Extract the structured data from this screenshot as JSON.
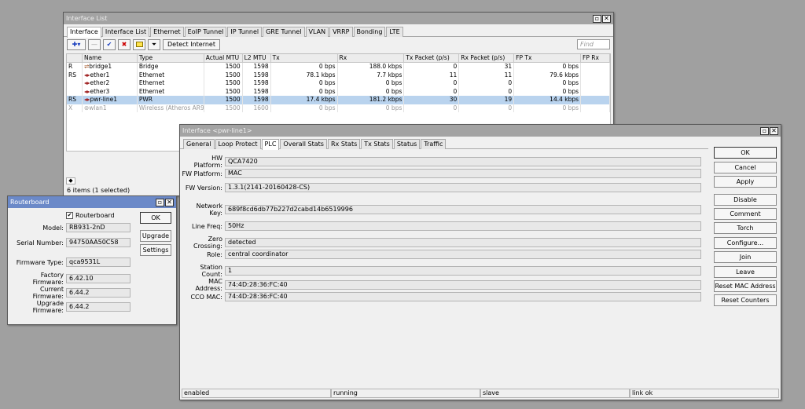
{
  "iface_list": {
    "title": "Interface List",
    "tabs": [
      "Interface",
      "Interface List",
      "Ethernet",
      "EoIP Tunnel",
      "IP Tunnel",
      "GRE Tunnel",
      "VLAN",
      "VRRP",
      "Bonding",
      "LTE"
    ],
    "detect_label": "Detect Internet",
    "find_placeholder": "Find",
    "columns": [
      "",
      "Name",
      "Type",
      "Actual MTU",
      "L2 MTU",
      "Tx",
      "Rx",
      "Tx Packet (p/s)",
      "Rx Packet (p/s)",
      "FP Tx",
      "FP Rx"
    ],
    "rows": [
      [
        "R",
        "bridge1",
        "Bridge",
        "1500",
        "1598",
        "0 bps",
        "188.0 kbps",
        "0",
        "31",
        "0 bps"
      ],
      [
        "RS",
        "ether1",
        "Ethernet",
        "1500",
        "1598",
        "78.1 kbps",
        "7.7 kbps",
        "11",
        "11",
        "79.6 kbps"
      ],
      [
        "",
        "ether2",
        "Ethernet",
        "1500",
        "1598",
        "0 bps",
        "0 bps",
        "0",
        "0",
        "0 bps"
      ],
      [
        "",
        "ether3",
        "Ethernet",
        "1500",
        "1598",
        "0 bps",
        "0 bps",
        "0",
        "0",
        "0 bps"
      ],
      [
        "RS",
        "pwr-line1",
        "PWR",
        "1500",
        "1598",
        "17.4 kbps",
        "181.2 kbps",
        "30",
        "19",
        "14.4 kbps"
      ],
      [
        "X",
        "wlan1",
        "Wireless (Atheros AR9...",
        "1500",
        "1600",
        "0 bps",
        "0 bps",
        "0",
        "0",
        "0 bps"
      ]
    ],
    "footer": "6 items (1 selected)"
  },
  "routerboard": {
    "title": "Routerboard",
    "checkbox_label": "Routerboard",
    "fields": [
      {
        "label": "Model:",
        "value": "RB931-2nD"
      },
      {
        "label": "Serial Number:",
        "value": "94750AA50C58"
      },
      {
        "label": "Firmware Type:",
        "value": "qca9531L"
      },
      {
        "label": "Factory Firmware:",
        "value": "6.42.10"
      },
      {
        "label": "Current Firmware:",
        "value": "6.44.2"
      },
      {
        "label": "Upgrade Firmware:",
        "value": "6.44.2"
      }
    ],
    "buttons": [
      "OK",
      "Upgrade",
      "Settings"
    ]
  },
  "plc": {
    "title": "Interface <pwr-line1>",
    "tabs": [
      "General",
      "Loop Protect",
      "PLC",
      "Overall Stats",
      "Rx Stats",
      "Tx Stats",
      "Status",
      "Traffic"
    ],
    "fields": [
      {
        "label": "HW Platform:",
        "value": "QCA7420"
      },
      {
        "label": "FW Platform:",
        "value": "MAC"
      },
      {
        "label": "FW Version:",
        "value": "1.3.1(2141-20160428-CS)"
      },
      {
        "label": "Network Key:",
        "value": "689f8cd6db77b227d2cabd14b6519996"
      },
      {
        "label": "Line Freq:",
        "value": "50Hz"
      },
      {
        "label": "Zero Crossing:",
        "value": "detected"
      },
      {
        "label": "Role:",
        "value": "central coordinator"
      },
      {
        "label": "Station Count:",
        "value": "1"
      },
      {
        "label": "MAC Address:",
        "value": "74:4D:28:36:FC:40"
      },
      {
        "label": "CCO MAC:",
        "value": "74:4D:28:36:FC:40"
      }
    ],
    "buttons": [
      "OK",
      "Cancel",
      "Apply",
      "Disable",
      "Comment",
      "Torch",
      "Configure...",
      "Join",
      "Leave",
      "Reset MAC Address",
      "Reset Counters"
    ],
    "status": [
      "enabled",
      "running",
      "slave",
      "link ok"
    ]
  },
  "colors": {
    "title_active": "#6b89c8",
    "selected_row": "#b9d3ee"
  }
}
